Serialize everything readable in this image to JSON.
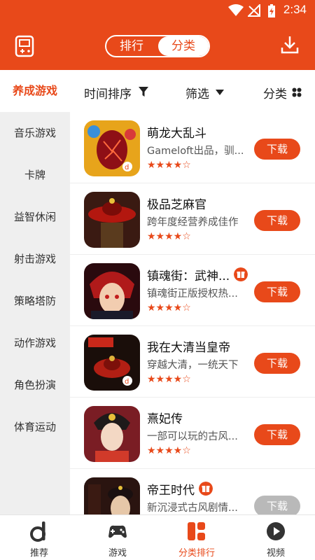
{
  "status": {
    "time": "2:34"
  },
  "header": {
    "segments": [
      "排行",
      "分类"
    ],
    "active_segment": "分类"
  },
  "sidebar": {
    "items": [
      {
        "label": "养成游戏",
        "active": true
      },
      {
        "label": "音乐游戏"
      },
      {
        "label": "卡牌"
      },
      {
        "label": "益智休闲"
      },
      {
        "label": "射击游戏"
      },
      {
        "label": "策略塔防"
      },
      {
        "label": "动作游戏"
      },
      {
        "label": "角色扮演"
      },
      {
        "label": "体育运动"
      }
    ]
  },
  "filters": {
    "sort": "时间排序",
    "filter": "筛选",
    "category": "分类"
  },
  "games": [
    {
      "name": "萌龙大乱斗",
      "desc": "Gameloft出品，驯...",
      "stars": "★★★★☆",
      "button": "下载",
      "gift": false
    },
    {
      "name": "极品芝麻官",
      "desc": "跨年度经营养成佳作",
      "stars": "★★★★☆",
      "button": "下载",
      "gift": false
    },
    {
      "name": "镇魂街：武神...",
      "desc": "镇魂街正版授权热...",
      "stars": "★★★★☆",
      "button": "下载",
      "gift": true
    },
    {
      "name": "我在大清当皇帝",
      "desc": "穿越大清，一统天下",
      "stars": "★★★★☆",
      "button": "下载",
      "gift": false
    },
    {
      "name": "熹妃传",
      "desc": "一部可以玩的古风...",
      "stars": "★★★★☆",
      "button": "下载",
      "gift": false
    },
    {
      "name": "帝王时代",
      "desc": "新沉浸式古风剧情...",
      "stars": "",
      "button": "下载",
      "gift": true
    }
  ],
  "tabbar": {
    "items": [
      {
        "label": "推荐",
        "icon": "d-logo-icon"
      },
      {
        "label": "游戏",
        "icon": "gamepad-icon"
      },
      {
        "label": "分类排行",
        "icon": "category-icon",
        "active": true
      },
      {
        "label": "视频",
        "icon": "play-icon"
      }
    ]
  },
  "colors": {
    "accent": "#e8491a",
    "disabled": "#b9b9b9",
    "sidebar_bg": "#efefef"
  }
}
